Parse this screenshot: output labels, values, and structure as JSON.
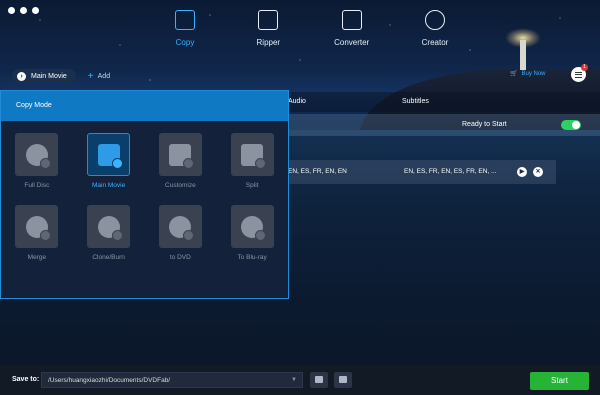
{
  "modes": [
    {
      "label": "Copy",
      "icon": "copy-icon",
      "active": true
    },
    {
      "label": "Ripper",
      "icon": "ripper-icon",
      "active": false
    },
    {
      "label": "Converter",
      "icon": "converter-icon",
      "active": false
    },
    {
      "label": "Creator",
      "icon": "creator-icon",
      "active": false
    }
  ],
  "source": {
    "label": "Main Movie",
    "add_label": "Add"
  },
  "buy_now": "Buy Now",
  "menu_badge": "1",
  "columns": {
    "audio": "Audio",
    "subtitles": "Subtitles"
  },
  "title_row": {
    "status": "Ready to Start"
  },
  "stream_row": {
    "audio": "EN, ES, FR, EN, EN",
    "subtitles": "EN, ES, FR, EN, ES, FR, EN, ..."
  },
  "copy_mode": {
    "title": "Copy Mode",
    "tiles": [
      {
        "label": "Full Disc",
        "icon": "disc-icon"
      },
      {
        "label": "Main Movie",
        "icon": "film-icon",
        "active": true
      },
      {
        "label": "Customize",
        "icon": "edit-icon"
      },
      {
        "label": "Split",
        "icon": "crop-icon"
      },
      {
        "label": "Merge",
        "icon": "link-icon"
      },
      {
        "label": "Clone/Burn",
        "icon": "flame-icon"
      },
      {
        "label": "to DVD",
        "icon": "dvd-icon"
      },
      {
        "label": "To Blu-ray",
        "icon": "bluray-icon"
      }
    ]
  },
  "bottom": {
    "save_label": "Save to:",
    "path": "/Users/huangxiaozhi/Documents/DVDFab/",
    "start_label": "Start"
  },
  "colors": {
    "accent": "#38b3ff",
    "start": "#25b436",
    "toggle": "#2bd163",
    "panel_head": "#0f79c4"
  }
}
